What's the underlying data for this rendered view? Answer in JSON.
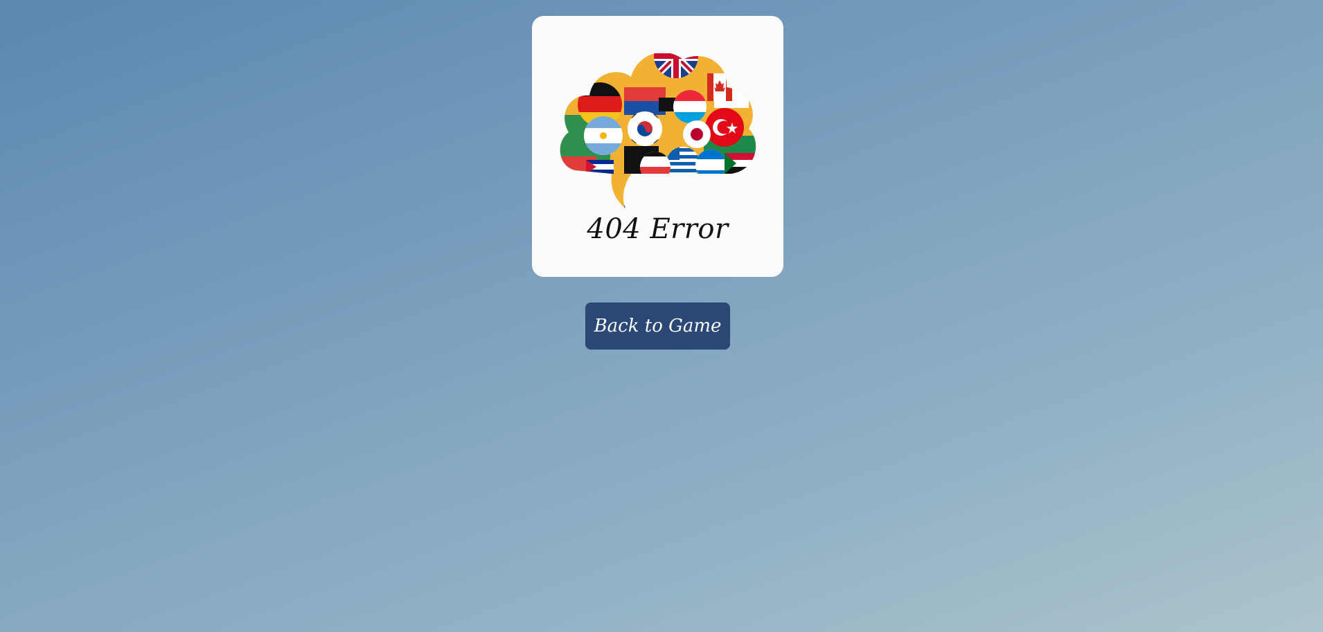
{
  "error_card": {
    "image": "flag-speech-bubble-cloud-icon",
    "title": "404 Error"
  },
  "actions": {
    "back_label": "Back to Game"
  },
  "colors": {
    "card_bg": "#fcfbfb",
    "button_bg": "#2b4775",
    "button_text": "#ffffff",
    "title_text": "#111111",
    "bg_gradient_start": "#5b87b0",
    "bg_gradient_end": "#adc4cd"
  }
}
